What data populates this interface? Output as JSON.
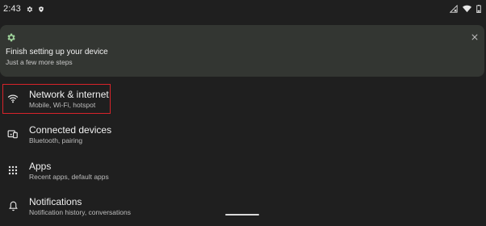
{
  "status_bar": {
    "time": "2:43",
    "left_icons": [
      "gear-icon",
      "shield-icon"
    ],
    "right_icons": [
      "signal-off-icon",
      "wifi-icon",
      "battery-icon"
    ]
  },
  "setup_card": {
    "title": "Finish setting up your device",
    "subtitle": "Just a few more steps",
    "icon": "gear-icon",
    "dismiss_icon": "close-icon",
    "accent_color": "#9fd49b"
  },
  "settings": {
    "items": [
      {
        "title": "Network & internet",
        "summary": "Mobile, Wi-Fi, hotspot",
        "icon": "wifi-icon"
      },
      {
        "title": "Connected devices",
        "summary": "Bluetooth, pairing",
        "icon": "connected-devices-icon"
      },
      {
        "title": "Apps",
        "summary": "Recent apps, default apps",
        "icon": "apps-grid-icon"
      },
      {
        "title": "Notifications",
        "summary": "Notification history, conversations",
        "icon": "bell-icon"
      }
    ]
  },
  "highlight_color": "#d8232a"
}
